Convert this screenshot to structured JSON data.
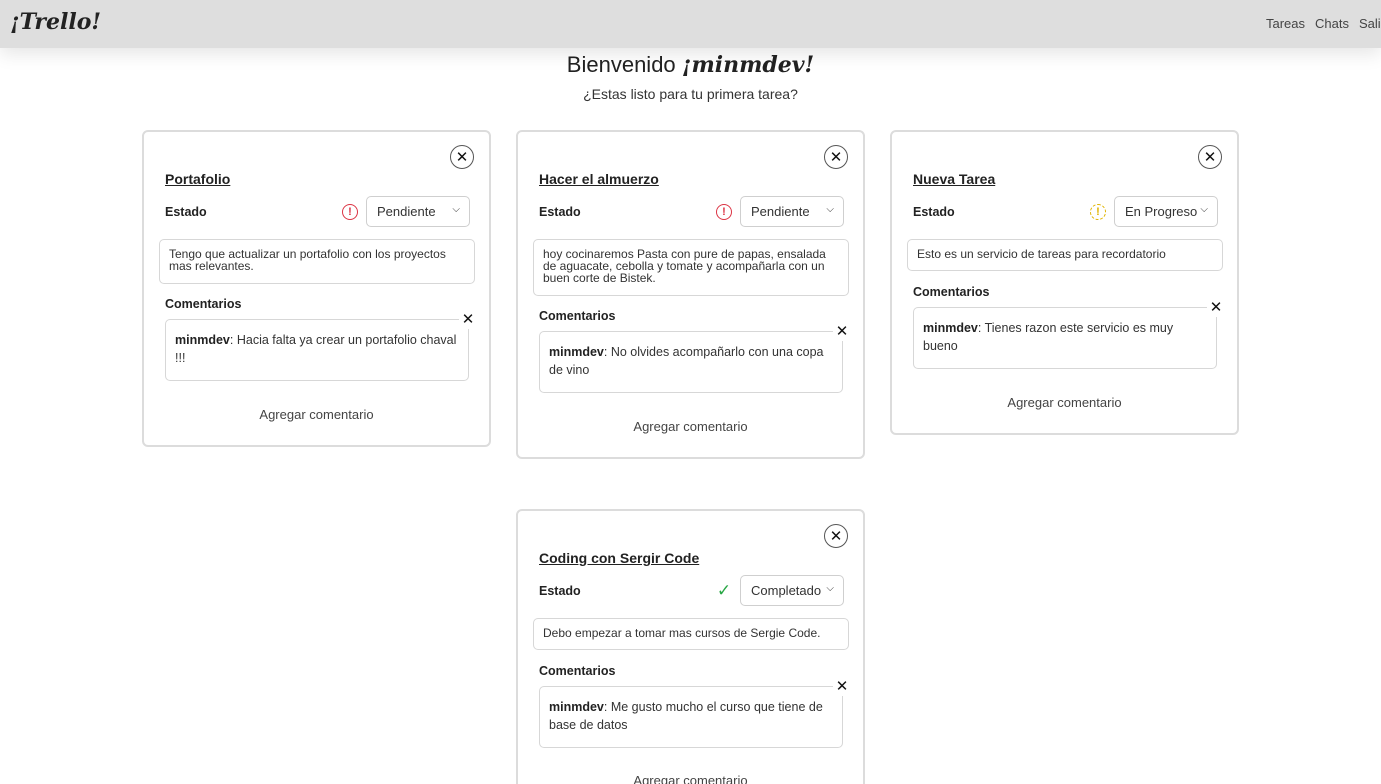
{
  "app": {
    "brand": "¡Trello!"
  },
  "nav": {
    "items": [
      "Tareas",
      "Chats",
      "Salir"
    ]
  },
  "welcome": {
    "greeting": "Bienvenido",
    "username": "¡minmdev!",
    "subtitle": "¿Estas listo para tu primera tarea?"
  },
  "common": {
    "estado_label": "Estado",
    "comments_label": "Comentarios",
    "add_comment": "Agregar comentario"
  },
  "icons": {
    "close": "close-icon",
    "pending": "alert-circle-icon",
    "progress": "clock-icon",
    "done": "check-icon",
    "dropdown": "chevron-down-icon"
  },
  "colors": {
    "pending": "#dc3545",
    "progress": "#e0b400",
    "done": "#28a745",
    "navbar": "#dedede"
  },
  "tasks": [
    {
      "title": "Portafolio",
      "status": "Pendiente",
      "description": "Tengo que actualizar un portafolio con los proyectos mas relevantes.",
      "comments": [
        {
          "user": "minmdev",
          "text": ": Hacia falta ya crear un portafolio chaval !!!"
        }
      ]
    },
    {
      "title": "Hacer el almuerzo",
      "status": "Pendiente",
      "description": "hoy cocinaremos Pasta con pure de papas, ensalada de aguacate, cebolla y tomate y acompañarla con un buen corte de Bistek.",
      "comments": [
        {
          "user": "minmdev",
          "text": ": No olvides acompañarlo con una copa de vino"
        }
      ]
    },
    {
      "title": "Nueva Tarea",
      "status": "En Progreso",
      "description": "Esto es un servicio de tareas para recordatorio",
      "comments": [
        {
          "user": "minmdev",
          "text": ": Tienes razon este servicio es muy bueno"
        }
      ]
    },
    {
      "title": "Coding con Sergir Code",
      "status": "Completado",
      "description": "Debo empezar a tomar mas cursos de Sergie Code.",
      "comments": [
        {
          "user": "minmdev",
          "text": ": Me gusto mucho el curso que tiene de base de datos"
        }
      ]
    }
  ]
}
